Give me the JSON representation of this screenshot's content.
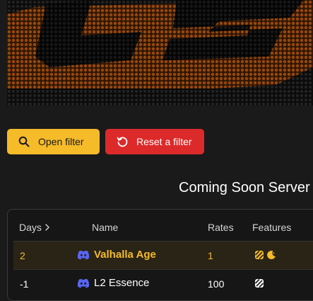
{
  "filters": {
    "open_label": "Open filter",
    "reset_label": "Reset a filter",
    "open_icon": "search-icon",
    "reset_icon": "reset-icon"
  },
  "section": {
    "title": "Coming Soon Server"
  },
  "table": {
    "headers": {
      "days": "Days",
      "name": "Name",
      "rates": "Rates",
      "features": "Features"
    },
    "rows": [
      {
        "days": "2",
        "name": "Valhalla Age",
        "rates": "1",
        "feature_icons": [
          "striped-badge-icon",
          "moon-icon"
        ],
        "highlighted": true
      },
      {
        "days": "-1",
        "name": "L2 Essence",
        "rates": "100",
        "feature_icons": [
          "striped-badge-icon"
        ],
        "highlighted": false
      }
    ]
  },
  "colors": {
    "accent": "#f5bb29",
    "danger": "#dc2a2a",
    "discord": "#5865f2",
    "background": "#1a1a1a"
  }
}
